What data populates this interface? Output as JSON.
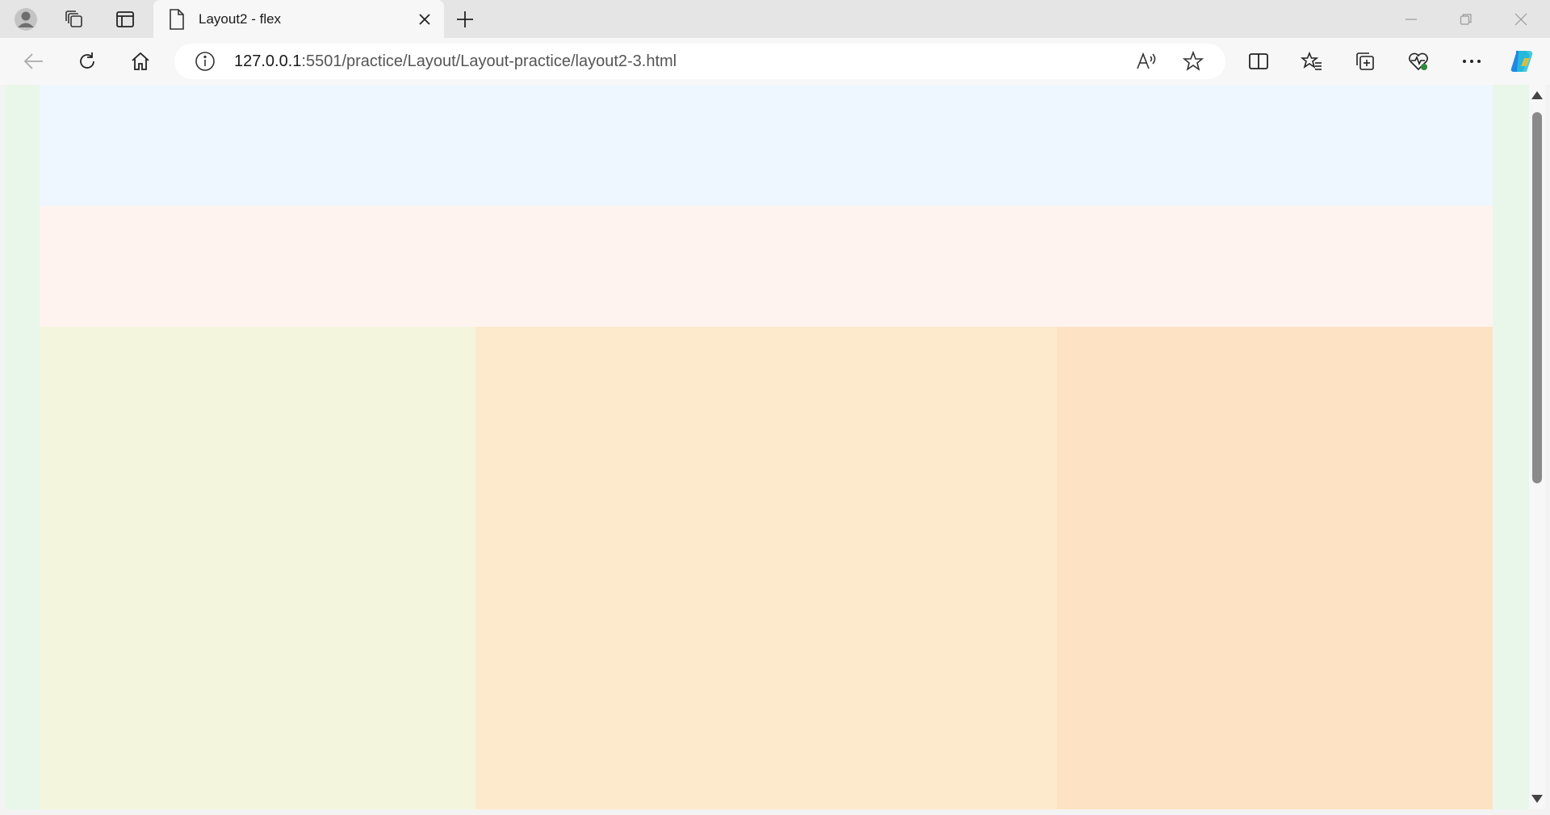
{
  "browser": {
    "tab": {
      "title": "Layout2 - flex"
    },
    "address": {
      "host": "127.0.0.1",
      "path": ":5501/practice/Layout/Layout-practice/layout2-3.html"
    }
  },
  "page": {
    "colors": {
      "body": "#e9f7ea",
      "row1": "#eef6ff",
      "row2": "#fff3ef",
      "col1": "#f3f5dd",
      "col2": "#fdeacc",
      "col3": "#fde3c3"
    }
  }
}
